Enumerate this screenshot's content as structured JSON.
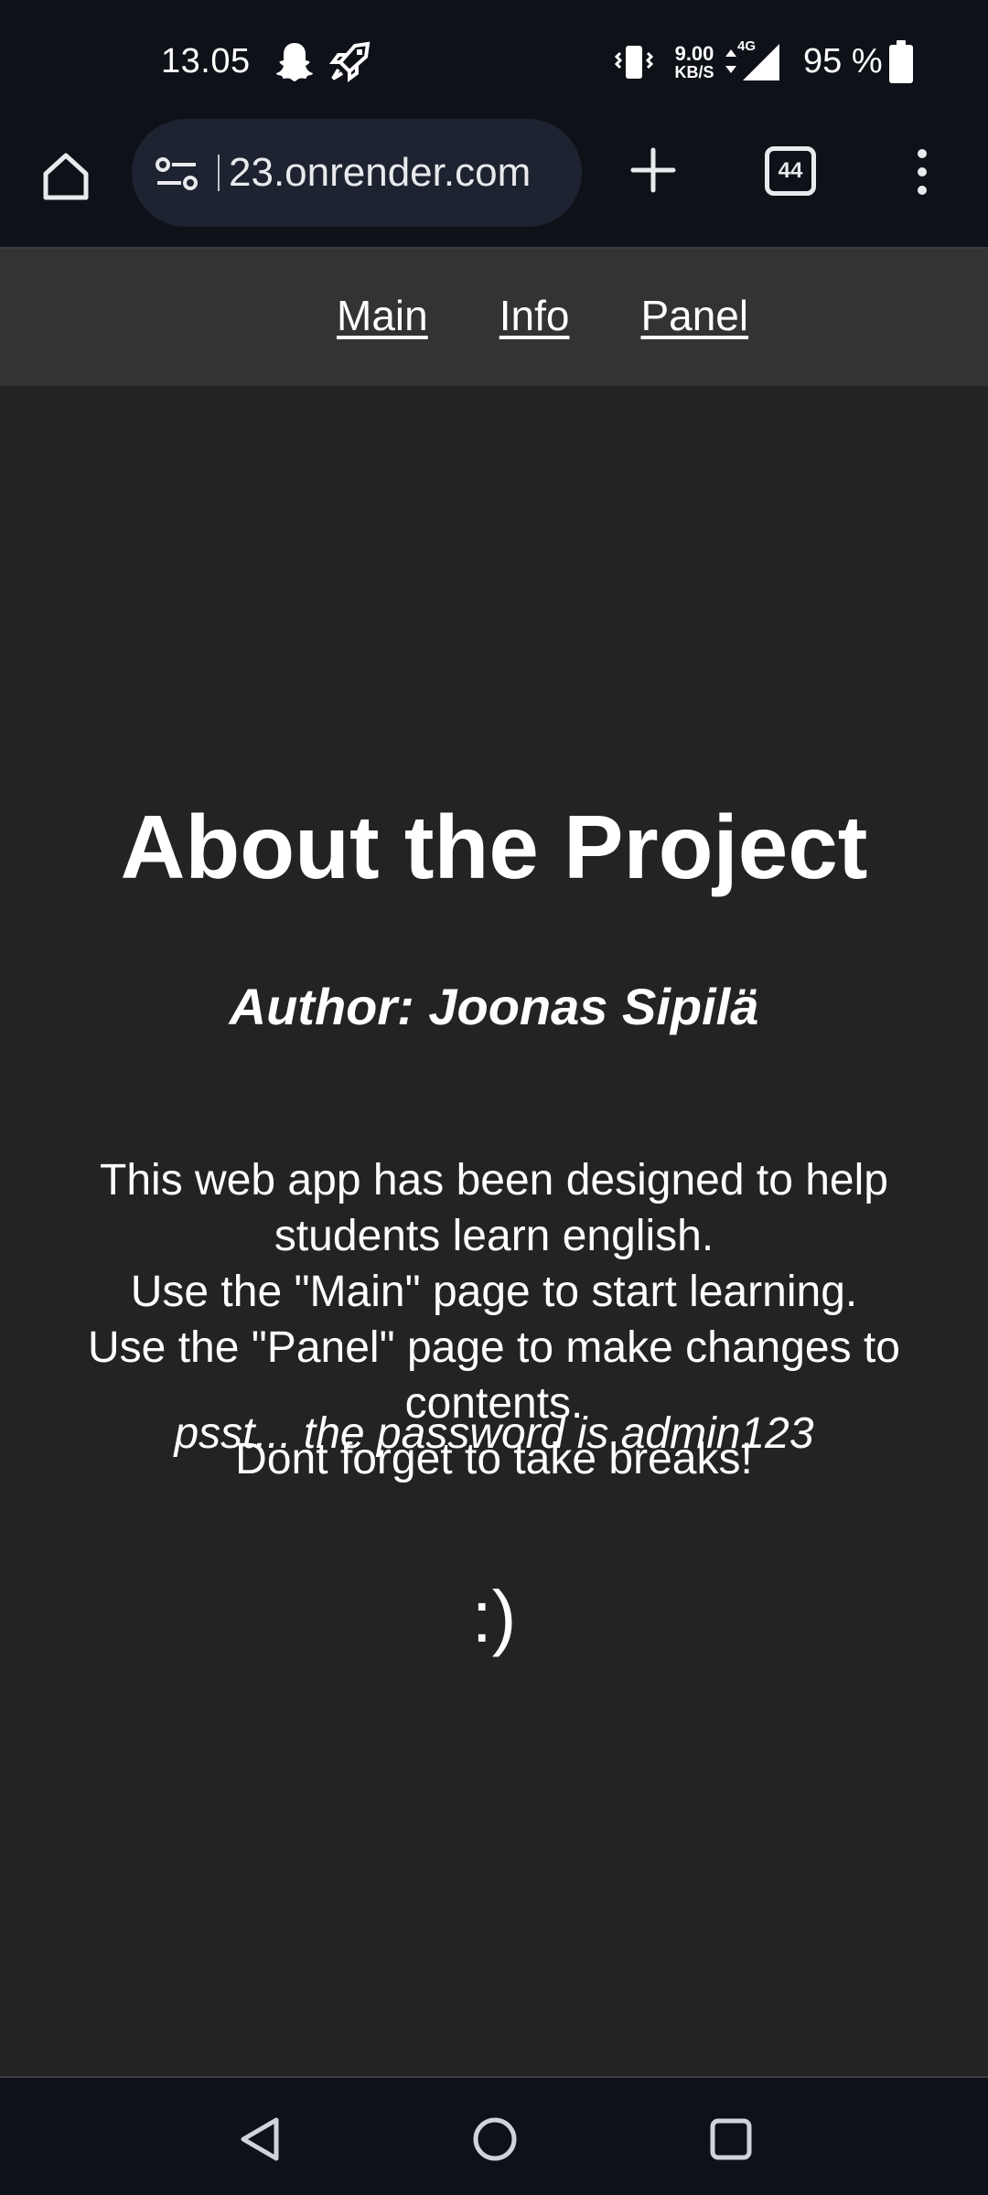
{
  "status_bar": {
    "time": "13.05",
    "speed_value": "9.00",
    "speed_unit": "KB/S",
    "network": "4G",
    "battery": "95 %",
    "icons": [
      "snapchat-ghost-icon",
      "rocket-icon",
      "vibrate-icon",
      "data-arrows-icon",
      "signal-icon",
      "battery-icon"
    ]
  },
  "browser": {
    "url": "23.onrender.com",
    "tab_count": "44",
    "icons": [
      "home-icon",
      "site-settings-icon",
      "plus-icon",
      "tabs-icon",
      "more-vert-icon"
    ]
  },
  "nav": {
    "links": [
      "Main",
      "Info",
      "Panel"
    ]
  },
  "page": {
    "title": "About the Project",
    "author": "Author: Joonas Sipilä",
    "description": [
      "This web app has been designed to help students learn english.",
      "Use the \"Main\" page to start learning.",
      "Use the \"Panel\" page to make changes to contents.",
      "Dont forget to take breaks!"
    ],
    "hint": "psst... the password is admin123",
    "smiley": ":)"
  },
  "android_nav": {
    "icons": [
      "back-icon",
      "home-circle-icon",
      "recents-icon"
    ]
  },
  "colors": {
    "system_bar": "#0e1118",
    "nav_bg": "#333333",
    "page_bg": "#232323",
    "url_box": "#1d2330",
    "text": "#ffffff"
  }
}
